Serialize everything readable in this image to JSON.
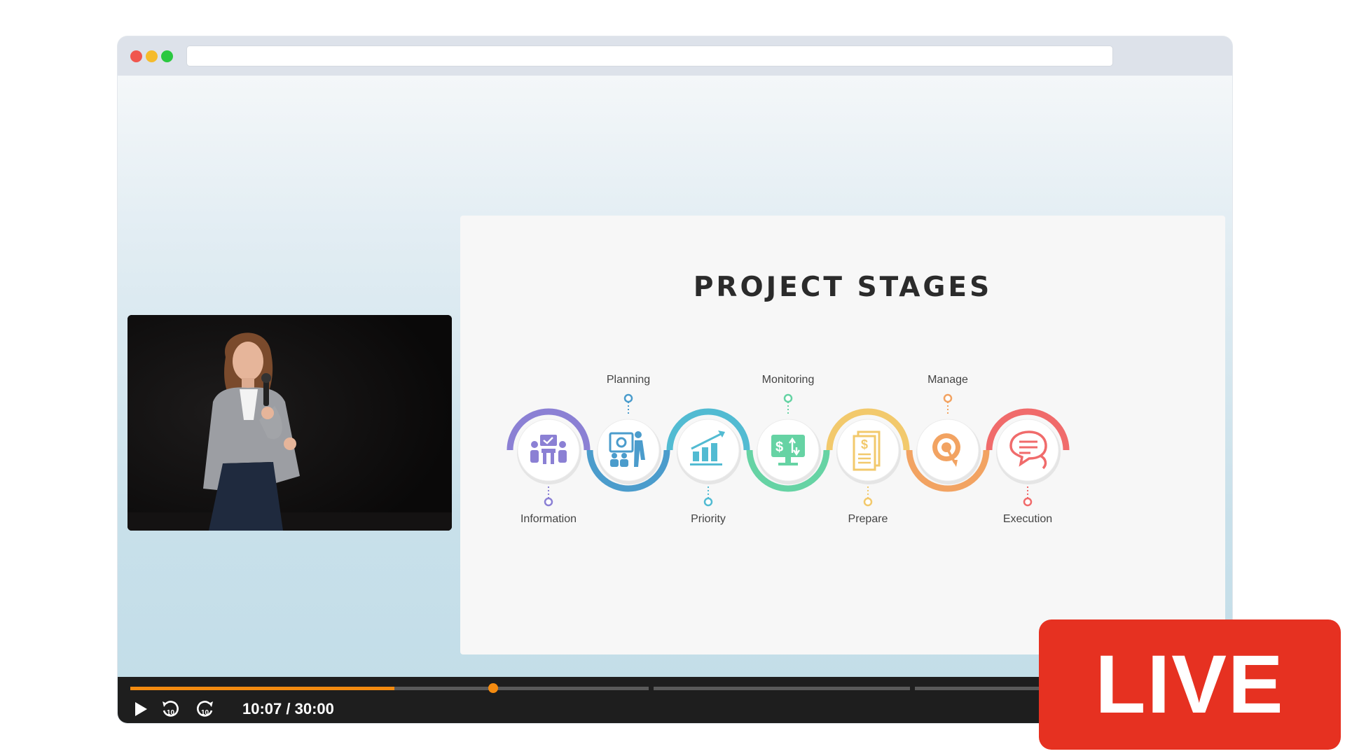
{
  "window": {
    "url": ""
  },
  "slide": {
    "title": "PROJECT STAGES",
    "stages": [
      {
        "label": "Information",
        "color": "#8b80d4",
        "icon": "meeting-team-icon"
      },
      {
        "label": "Planning",
        "color": "#4b9ccc",
        "icon": "presentation-board-icon"
      },
      {
        "label": "Priority",
        "color": "#52bbd2",
        "icon": "growth-chart-icon"
      },
      {
        "label": "Monitoring",
        "color": "#66d3a4",
        "icon": "money-monitor-icon"
      },
      {
        "label": "Prepare",
        "color": "#f2c96c",
        "icon": "document-dollar-icon"
      },
      {
        "label": "Manage",
        "color": "#f2a362",
        "icon": "target-icon"
      },
      {
        "label": "Execution",
        "color": "#f06b6b",
        "icon": "chat-bubbles-icon"
      }
    ]
  },
  "player": {
    "time_display": "10:07 / 30:00",
    "progress": 0.337,
    "colors": {
      "played": "#f48b10",
      "track": "#5a5a5a"
    }
  },
  "badge": {
    "text": "LIVE",
    "color": "#e63121"
  }
}
